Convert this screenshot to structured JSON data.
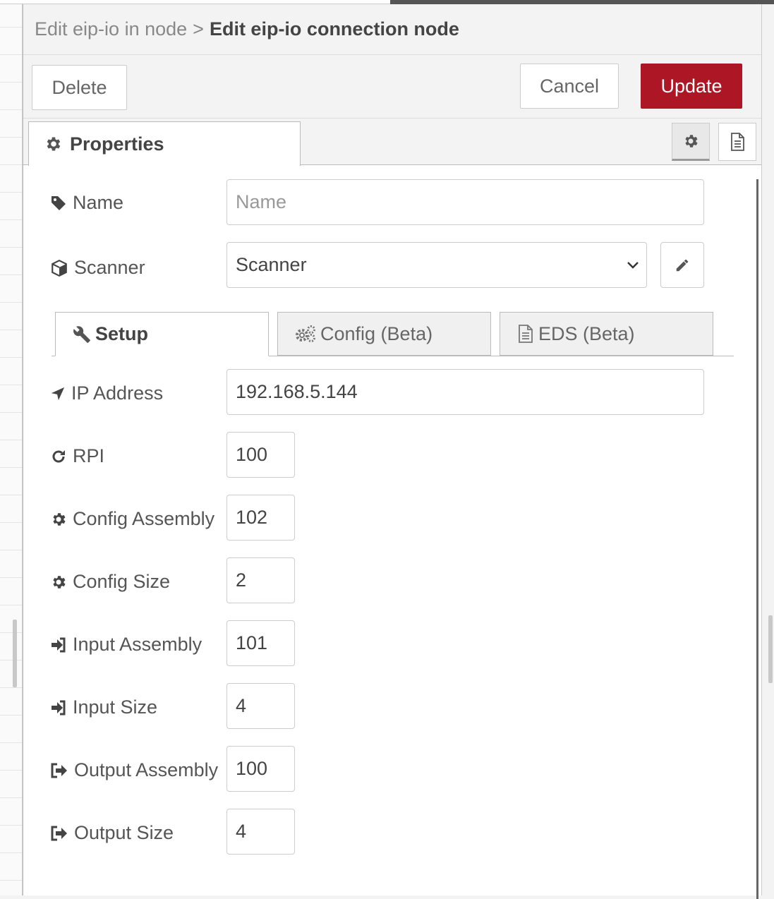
{
  "header": {
    "breadcrumb_parent": "Edit eip-io in node",
    "breadcrumb_separator": ">",
    "breadcrumb_current": "Edit eip-io connection node"
  },
  "toolbar": {
    "delete_label": "Delete",
    "cancel_label": "Cancel",
    "update_label": "Update",
    "update_color": "#ad1625"
  },
  "tabs": {
    "properties_label": "Properties",
    "properties_icon": "gear-icon",
    "side_icons": [
      "gear-icon",
      "document-icon"
    ]
  },
  "form": {
    "name": {
      "label": "Name",
      "icon": "tag-icon",
      "value": "",
      "placeholder": "Name"
    },
    "scanner": {
      "label": "Scanner",
      "icon": "cube-icon",
      "value": "Scanner",
      "edit_icon": "pencil-icon"
    },
    "subtabs": [
      {
        "label": "Setup",
        "icon": "wrench-icon",
        "active": true
      },
      {
        "label": "Config (Beta)",
        "icon": "gears-icon",
        "active": false
      },
      {
        "label": "EDS (Beta)",
        "icon": "file-icon",
        "active": false
      }
    ],
    "ip_address": {
      "label": "IP Address",
      "icon": "location-arrow-icon",
      "value": "192.168.5.144"
    },
    "rpi": {
      "label": "RPI",
      "icon": "refresh-icon",
      "value": "100"
    },
    "config_assembly": {
      "label": "Config Assembly",
      "icon": "gear-icon",
      "value": "102"
    },
    "config_size": {
      "label": "Config Size",
      "icon": "gear-icon",
      "value": "2"
    },
    "input_assembly": {
      "label": "Input Assembly",
      "icon": "sign-in-icon",
      "value": "101"
    },
    "input_size": {
      "label": "Input Size",
      "icon": "sign-in-icon",
      "value": "4"
    },
    "output_assembly": {
      "label": "Output Assembly",
      "icon": "sign-out-icon",
      "value": "100"
    },
    "output_size": {
      "label": "Output Size",
      "icon": "sign-out-icon",
      "value": "4"
    }
  }
}
